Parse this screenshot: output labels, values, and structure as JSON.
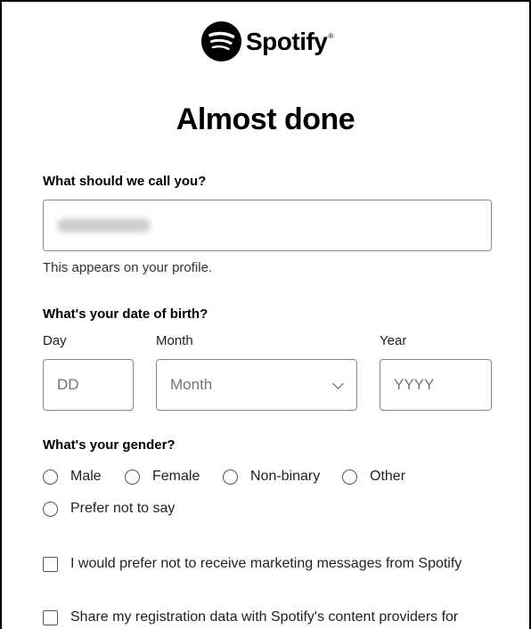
{
  "brand": {
    "name": "Spotify",
    "registered_mark": "®",
    "logo_icon": "spotify-logo-icon",
    "color": "#000000"
  },
  "page": {
    "title": "Almost done"
  },
  "name_section": {
    "label": "What should we call you?",
    "value": "(blurred name)",
    "hint": "This appears on your profile."
  },
  "dob_section": {
    "label": "What's your date of birth?",
    "day": {
      "label": "Day",
      "placeholder": "DD"
    },
    "month": {
      "label": "Month",
      "placeholder": "Month"
    },
    "year": {
      "label": "Year",
      "placeholder": "YYYY"
    }
  },
  "gender_section": {
    "label": "What's your gender?",
    "options": [
      "Male",
      "Female",
      "Non-binary",
      "Other",
      "Prefer not to say"
    ]
  },
  "consents": {
    "marketing": "I would prefer not to receive marketing messages from Spotify",
    "share_data": "Share my registration data with Spotify's content providers for"
  }
}
